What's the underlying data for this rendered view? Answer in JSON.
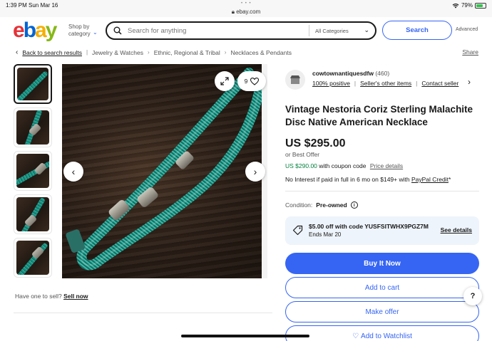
{
  "status_bar": {
    "time": "1:39 PM",
    "date": "Sun Mar 16",
    "url": "ebay.com",
    "battery": "79%",
    "battery_fraction": 0.79
  },
  "header": {
    "logo": {
      "e": "e",
      "b": "b",
      "a": "a",
      "y": "y"
    },
    "shop_by": "Shop by category",
    "search_placeholder": "Search for anything",
    "category": "All Categories",
    "search_button": "Search",
    "advanced": "Advanced"
  },
  "breadcrumb": {
    "back": "Back to search results",
    "items": [
      "Jewelry & Watches",
      "Ethnic, Regional & Tribal",
      "Necklaces & Pendants"
    ],
    "share": "Share"
  },
  "gallery": {
    "watch_count": "9",
    "thumb_count": 5
  },
  "seller": {
    "name": "cowtownantiquesdfw",
    "feedback_count": "(460)",
    "positive": "100% positive",
    "other_items": "Seller's other items",
    "contact": "Contact seller"
  },
  "listing": {
    "title": "Vintage Nestoria Coriz Sterling Malachite Disc Native American Necklace",
    "price": "US $295.00",
    "best_offer": "or Best Offer",
    "coupon_price": "US $290.00",
    "coupon_suffix": "with coupon code",
    "price_details": "Price details",
    "interest_text": "No Interest if paid in full in 6 mo on $149+ with",
    "paypal_credit": "PayPal Credit",
    "interest_star": "*",
    "condition_label": "Condition:",
    "condition_value": "Pre-owned",
    "coupon_line1": "$5.00 off with code YUSFSITWHX9PGZ7M",
    "coupon_line2": "Ends Mar 20",
    "see_details": "See details"
  },
  "actions": {
    "buy_now": "Buy It Now",
    "add_to_cart": "Add to cart",
    "make_offer": "Make offer",
    "watchlist": "Add to Watchlist"
  },
  "sell": {
    "prompt": "Have one to sell?",
    "link": "Sell now"
  },
  "help": "?",
  "colors": {
    "accent": "#3665f3",
    "green": "#05823f",
    "ebay_red": "#e53238",
    "ebay_blue": "#0064d2",
    "ebay_yellow": "#f5af02",
    "ebay_green": "#86b817"
  }
}
